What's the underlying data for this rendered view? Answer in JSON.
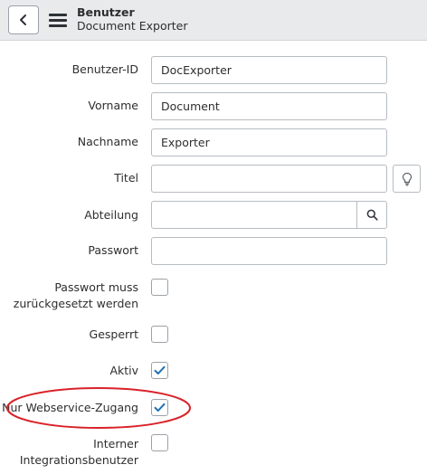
{
  "header": {
    "title": "Benutzer",
    "subtitle": "Document Exporter",
    "back_icon": "chevron-left-icon",
    "menu_icon": "hamburger-menu-icon"
  },
  "form": {
    "user_id": {
      "label": "Benutzer-ID",
      "value": "DocExporter"
    },
    "first_name": {
      "label": "Vorname",
      "value": "Document"
    },
    "last_name": {
      "label": "Nachname",
      "value": "Exporter"
    },
    "title": {
      "label": "Titel",
      "value": ""
    },
    "department": {
      "label": "Abteilung",
      "value": ""
    },
    "password": {
      "label": "Passwort",
      "value": ""
    },
    "password_reset": {
      "label_line1": "Passwort muss",
      "label_line2": "zurückgesetzt werden",
      "checked": false
    },
    "locked": {
      "label": "Gesperrt",
      "checked": false
    },
    "active": {
      "label": "Aktiv",
      "checked": true
    },
    "web_service_only": {
      "label": "Nur Webservice-Zugang",
      "checked": true
    },
    "internal_integration_user": {
      "label_line1": "Interner",
      "label_line2": "Integrationsbenutzer",
      "checked": false
    }
  },
  "colors": {
    "accent": "#1f6fb2",
    "highlight": "#d9232a",
    "header_bg": "#e8eaec"
  }
}
